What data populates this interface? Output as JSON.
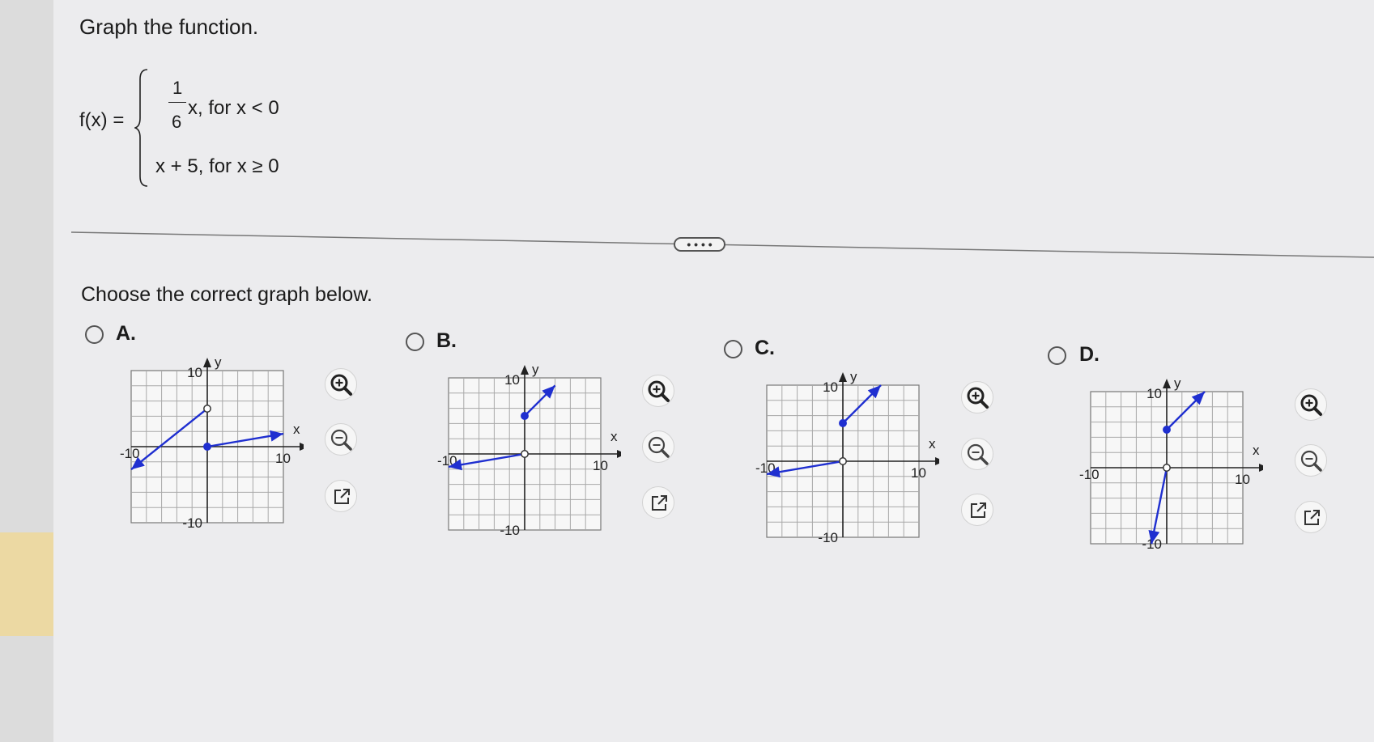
{
  "question": {
    "prompt": "Graph the function.",
    "function_label": "f(x) =",
    "piece1": {
      "numerator": "1",
      "denominator": "6",
      "expr": "x, for x < 0"
    },
    "piece2": {
      "expr": "x + 5, for x ≥ 0"
    }
  },
  "divider": {
    "more_label": "• • • •"
  },
  "choose_text": "Choose the correct graph below.",
  "options": [
    {
      "letter": "A.",
      "selected": false
    },
    {
      "letter": "B.",
      "selected": false
    },
    {
      "letter": "C.",
      "selected": false
    },
    {
      "letter": "D.",
      "selected": false
    }
  ],
  "graph_labels": {
    "x_axis": "x",
    "y_axis": "y",
    "pos_tick": "10",
    "neg_tick": "-10"
  },
  "tools": {
    "zoom_in_icon": "zoom-in-icon",
    "zoom_out_icon": "zoom-out-icon",
    "popout_icon": "external-link-icon"
  },
  "colors": {
    "curve": "#1f2fd0",
    "grid": "#a8a8a8",
    "axis": "#222222"
  },
  "chart_data": [
    {
      "type": "line",
      "option": "A",
      "xlim": [
        -10,
        10
      ],
      "ylim": [
        -10,
        10
      ],
      "series": [
        {
          "points": [
            [
              -10,
              -3
            ],
            [
              0,
              5
            ]
          ],
          "arrow_at": "start",
          "endpoint": {
            "at": [
              0,
              5
            ],
            "closed": false
          }
        },
        {
          "points": [
            [
              0,
              0
            ],
            [
              10,
              1.7
            ]
          ],
          "arrow_at": "end",
          "endpoint": {
            "at": [
              0,
              0
            ],
            "closed": true
          }
        }
      ]
    },
    {
      "type": "line",
      "option": "B",
      "xlim": [
        -10,
        10
      ],
      "ylim": [
        -10,
        10
      ],
      "series": [
        {
          "points": [
            [
              -10,
              -1.7
            ],
            [
              0,
              0
            ]
          ],
          "arrow_at": "start",
          "endpoint": {
            "at": [
              0,
              0
            ],
            "closed": false
          }
        },
        {
          "points": [
            [
              0,
              5
            ],
            [
              4,
              9
            ]
          ],
          "arrow_at": "end",
          "endpoint": {
            "at": [
              0,
              5
            ],
            "closed": true
          }
        }
      ]
    },
    {
      "type": "line",
      "option": "C",
      "xlim": [
        -10,
        10
      ],
      "ylim": [
        -10,
        10
      ],
      "series": [
        {
          "points": [
            [
              -10,
              -1.7
            ],
            [
              0,
              0
            ]
          ],
          "arrow_at": "start",
          "endpoint": {
            "at": [
              0,
              0
            ],
            "closed": false
          }
        },
        {
          "points": [
            [
              0,
              5
            ],
            [
              5,
              10
            ]
          ],
          "arrow_at": "end",
          "endpoint": {
            "at": [
              0,
              5
            ],
            "closed": true
          }
        }
      ]
    },
    {
      "type": "line",
      "option": "D",
      "xlim": [
        -10,
        10
      ],
      "ylim": [
        -10,
        10
      ],
      "series": [
        {
          "points": [
            [
              -2,
              -10
            ],
            [
              0,
              0
            ]
          ],
          "arrow_at": "start",
          "endpoint": {
            "at": [
              0,
              0
            ],
            "closed": false
          }
        },
        {
          "points": [
            [
              0,
              5
            ],
            [
              5,
              10
            ]
          ],
          "arrow_at": "end",
          "endpoint": {
            "at": [
              0,
              5
            ],
            "closed": true
          }
        }
      ]
    }
  ]
}
